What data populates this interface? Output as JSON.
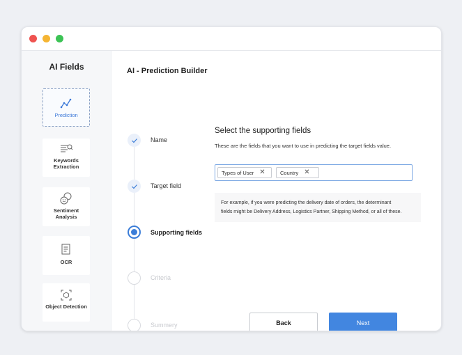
{
  "sidebar": {
    "title": "AI Fields",
    "items": [
      {
        "label": "Prediction",
        "icon": "trend-chart-icon",
        "active": true
      },
      {
        "label": "Keywords Extraction",
        "icon": "keywords-icon",
        "active": false
      },
      {
        "label": "Sentiment Analysis",
        "icon": "sentiment-face-icon",
        "active": false
      },
      {
        "label": "OCR",
        "icon": "document-scan-icon",
        "active": false
      },
      {
        "label": "Object Detection",
        "icon": "object-scan-icon",
        "active": false
      }
    ]
  },
  "main": {
    "title": "AI - Prediction Builder",
    "steps": [
      {
        "label": "Name",
        "state": "done"
      },
      {
        "label": "Target field",
        "state": "done"
      },
      {
        "label": "Supporting fields",
        "state": "active"
      },
      {
        "label": "Criteria",
        "state": "pending"
      },
      {
        "label": "Summery",
        "state": "pending"
      }
    ],
    "section_title": "Select the supporting fields",
    "section_desc": "These are the fields that you want to use in predicting the target fields value.",
    "chips": [
      "Types of User",
      "Country"
    ],
    "hint_line1": "For example, if you were predicting the delivery date of orders, the determinant",
    "hint_line2": "fields might be Delivery Address, Logistics Partner, Shipping Method, or all of these.",
    "back_label": "Back",
    "next_label": "Next"
  },
  "colors": {
    "accent": "#4286e0",
    "sidebar_bg": "#f6f7f9",
    "page_bg": "#eef0f4"
  }
}
